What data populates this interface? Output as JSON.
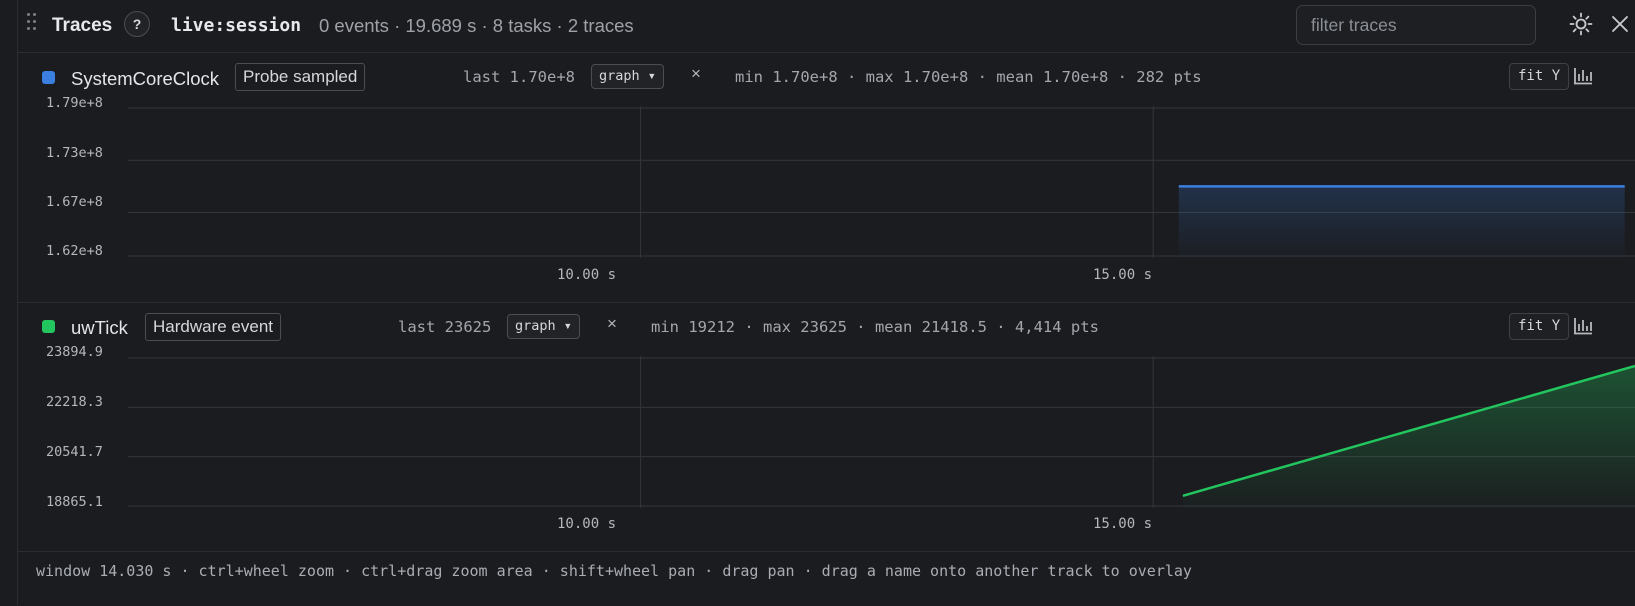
{
  "header": {
    "title": "Traces",
    "help_label": "?",
    "session": "live:session",
    "stats": "0 events · 19.689 s · 8 tasks · 2 traces",
    "filter_placeholder": "filter traces"
  },
  "colors": {
    "background": "#1b1c1f",
    "blue_series": "#3b7fe0",
    "green_series": "#22c55e",
    "grid": "#34363b"
  },
  "tracks": [
    {
      "name": "SystemCoreClock",
      "tag": "Probe sampled",
      "last": "last 1.70e+8",
      "mode": "graph ▾",
      "close": "×",
      "summary": "min 1.70e+8 · max 1.70e+8 · mean 1.70e+8 · 282 pts",
      "fit_label": "fit Y",
      "y_ticks": [
        "1.79e+8",
        "1.73e+8",
        "1.67e+8",
        "1.62e+8"
      ],
      "x_ticks": [
        "10.00 s",
        "15.00 s"
      ]
    },
    {
      "name": "uwTick",
      "tag": "Hardware event",
      "last": "last 23625",
      "mode": "graph ▾",
      "close": "×",
      "summary": "min 19212 · max 23625 · mean 21418.5 · 4,414 pts",
      "fit_label": "fit Y",
      "y_ticks": [
        "23894.9",
        "22218.3",
        "20541.7",
        "18865.1"
      ],
      "x_ticks": [
        "10.00 s",
        "15.00 s"
      ]
    }
  ],
  "chart_data": [
    {
      "type": "line",
      "series": [
        {
          "name": "SystemCoreClock",
          "x": [
            15.25,
            19.6
          ],
          "y": [
            170000000,
            170000000
          ]
        }
      ],
      "ylim": [
        162000000,
        179000000
      ],
      "xlim": [
        5.0,
        19.7
      ],
      "y_ticks": [
        179000000,
        173000000,
        167000000,
        162000000
      ],
      "x_ticks": [
        10.0,
        15.0
      ],
      "grid": true
    },
    {
      "type": "area",
      "series": [
        {
          "name": "uwTick",
          "x": [
            15.29,
            19.7
          ],
          "y": [
            19212,
            23625
          ]
        }
      ],
      "ylim": [
        18865.1,
        23894.9
      ],
      "xlim": [
        5.0,
        19.7
      ],
      "y_ticks": [
        23894.9,
        22218.3,
        20541.7,
        18865.1
      ],
      "x_ticks": [
        10.0,
        15.0
      ],
      "grid": true
    }
  ],
  "footer": {
    "hint": "window 14.030 s · ctrl+wheel zoom · ctrl+drag zoom area · shift+wheel pan · drag pan · drag a name onto another track to overlay"
  }
}
